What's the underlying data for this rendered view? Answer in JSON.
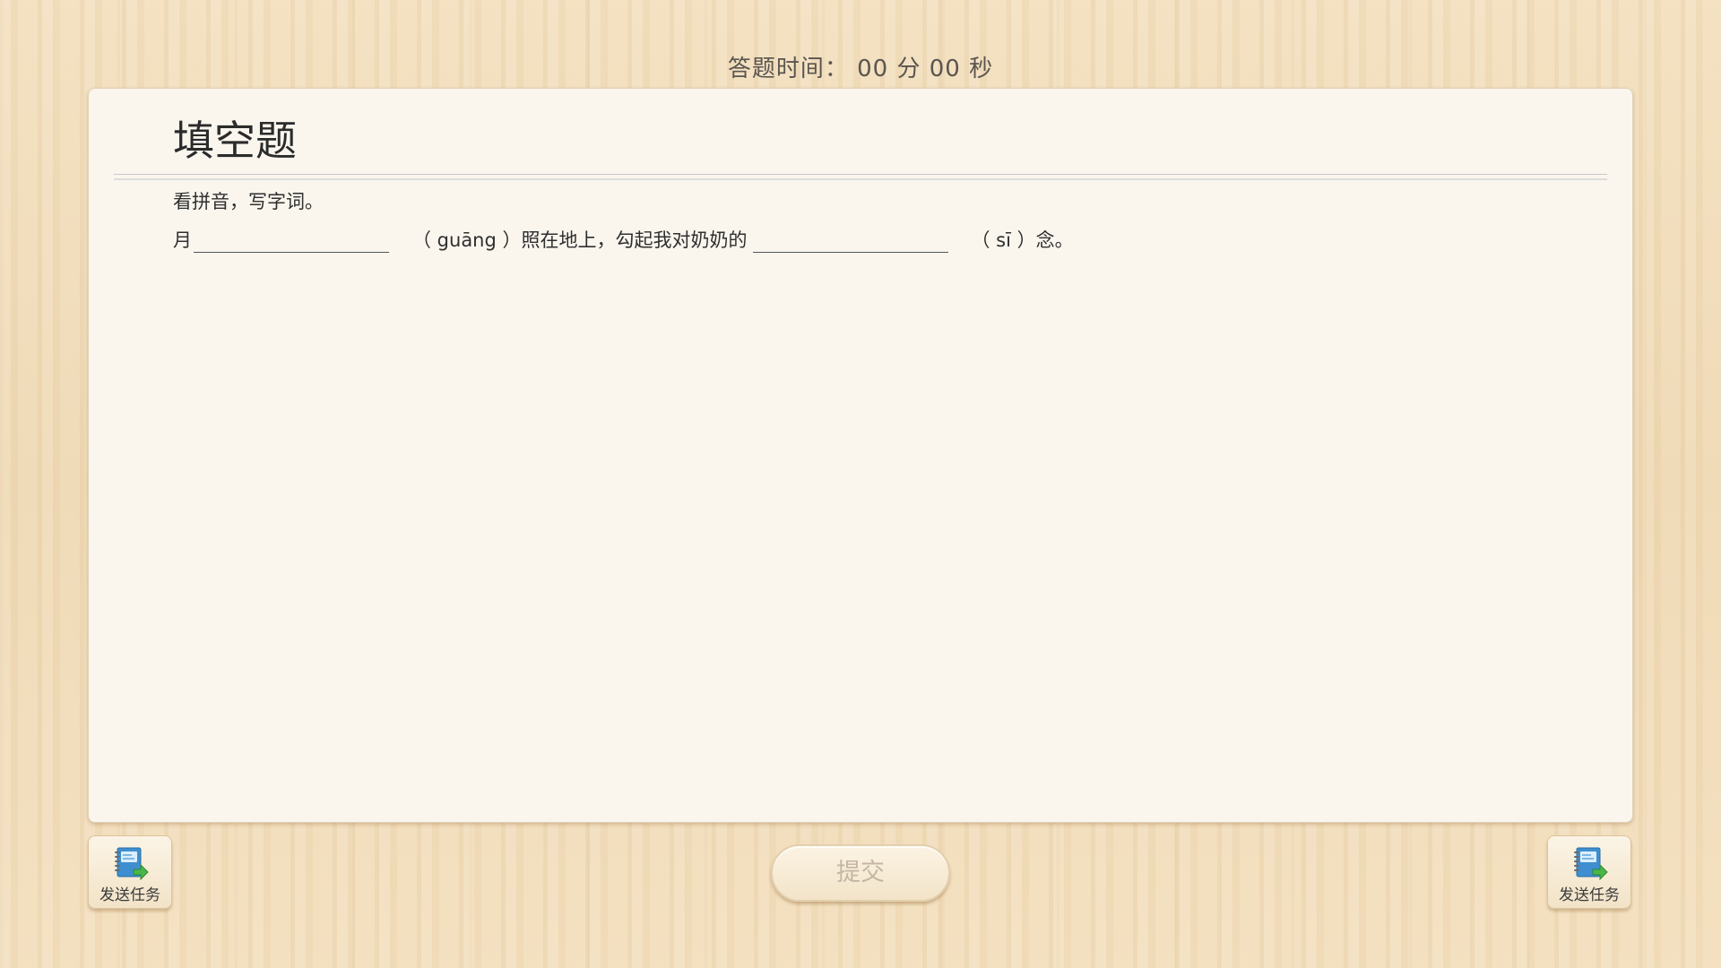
{
  "header": {
    "timer_label": "答题时间：",
    "minutes": "00",
    "minutes_unit": "分",
    "seconds": "00",
    "seconds_unit": "秒"
  },
  "panel": {
    "title": "填空题",
    "instruction": "看拼音，写字词。",
    "question": {
      "segment_1": "月",
      "blank_1_value": "",
      "segment_2": "（ guāng ）照在地上，勾起我对奶奶的",
      "blank_2_value": "",
      "segment_3": "（ sī ）念。"
    }
  },
  "footer": {
    "submit_label": "提交",
    "task_left_label": "发送任务",
    "task_right_label": "发送任务"
  },
  "icons": {
    "task_icon": "notebook-send-icon"
  }
}
